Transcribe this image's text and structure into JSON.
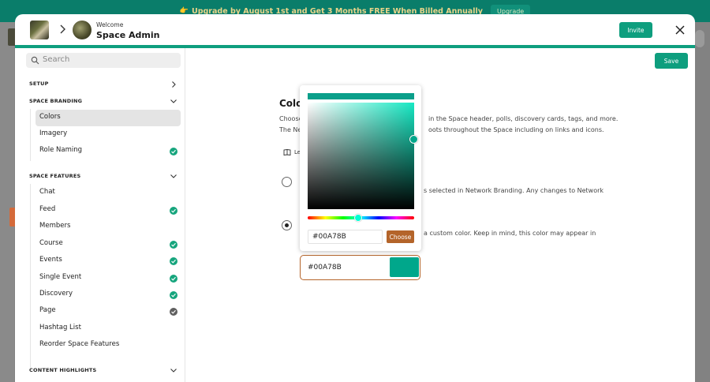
{
  "banner": {
    "emoji": "👉",
    "text": "Upgrade by August 1st and Get 3 Months FREE When Billed Annually",
    "button": "Upgrade"
  },
  "header": {
    "welcome": "Welcome",
    "name": "Space Admin",
    "invite_label": "Invite"
  },
  "sidebar": {
    "search_placeholder": "Search",
    "setup": "SETUP",
    "branding": "SPACE BRANDING",
    "features": "SPACE FEATURES",
    "highlights": "CONTENT HIGHLIGHTS",
    "branding_items": [
      {
        "label": "Colors",
        "active": true,
        "badge": "none"
      },
      {
        "label": "Imagery",
        "active": false,
        "badge": "none"
      },
      {
        "label": "Role Naming",
        "active": false,
        "badge": "green"
      }
    ],
    "feature_items": [
      {
        "label": "Chat",
        "badge": "none"
      },
      {
        "label": "Feed",
        "badge": "green"
      },
      {
        "label": "Members",
        "badge": "none"
      },
      {
        "label": "Course",
        "badge": "green"
      },
      {
        "label": "Events",
        "badge": "green"
      },
      {
        "label": "Single Event",
        "badge": "green"
      },
      {
        "label": "Discovery",
        "badge": "green"
      },
      {
        "label": "Page",
        "badge": "grey"
      },
      {
        "label": "Hashtag List",
        "badge": "none"
      },
      {
        "label": "Reorder Space Features",
        "badge": "none"
      }
    ]
  },
  "main": {
    "save_label": "Save",
    "title": "Colo",
    "desc1_left": "Choose",
    "desc1_right": "in the Space header, polls, discovery cards, tags, and more.",
    "desc2_left": "The Ne",
    "desc2_right": "oots throughout the Space including on links and icons.",
    "learn_text": "Le",
    "option1_text": "s selected in Network Branding. Any changes to Network",
    "option2_text": "a custom color. Keep in mind, this color may appear in",
    "option1_checked": false,
    "option2_checked": true,
    "color_value": "#00A78B"
  },
  "picker": {
    "hex_value": "#00A78B",
    "choose_label": "Choose",
    "hue_degrees": 170,
    "saturation": 1.0,
    "brightness": 0.65
  },
  "colors": {
    "accent": "#0E9E7E",
    "selected": "#00A78B",
    "choose": "#B4642A",
    "banner_bg": "#0A7D6A"
  },
  "icons": {
    "search": "search-icon",
    "close": "close-icon",
    "chevron_right": "chevron-right-icon",
    "chevron_down": "chevron-down-icon",
    "check": "check-icon",
    "book": "book-icon"
  }
}
